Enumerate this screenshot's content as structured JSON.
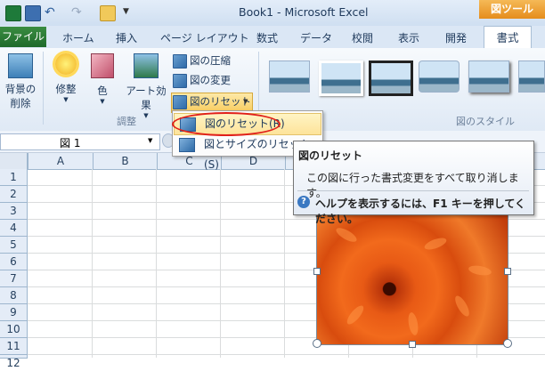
{
  "window": {
    "title": "Book1 - Microsoft Excel",
    "context_tool": "図ツール"
  },
  "tabs": {
    "file": "ファイル",
    "items": [
      "ホーム",
      "挿入",
      "ページ レイアウト",
      "数式",
      "データ",
      "校閲",
      "表示",
      "開発"
    ],
    "active": "書式"
  },
  "ribbon": {
    "remove_bg": "背景の\n削除",
    "remove_bg_line1": "背景の",
    "remove_bg_line2": "削除",
    "corrections": "修整",
    "color": "色",
    "artistic": "アート効果",
    "compress": "図の圧縮",
    "change": "図の変更",
    "reset": "図のリセット",
    "group_adjust": "調整",
    "group_styles": "図のスタイル"
  },
  "menu": {
    "item1": "図のリセット(R)",
    "item2": "図とサイズのリセット(S)"
  },
  "tooltip": {
    "title": "図のリセット",
    "body": "この図に行った書式変更をすべて取り消します。",
    "help": "ヘルプを表示するには、F1 キーを押してください。"
  },
  "namebox": {
    "value": "図 1"
  },
  "columns": [
    "A",
    "B",
    "C",
    "D"
  ],
  "rows": [
    "1",
    "2",
    "3",
    "4",
    "5",
    "6",
    "7",
    "8",
    "9",
    "10",
    "11",
    "12"
  ],
  "colors": {
    "accent_orange": "#f0a030",
    "file_green": "#2a7a35",
    "highlight_red": "#e0201a"
  }
}
